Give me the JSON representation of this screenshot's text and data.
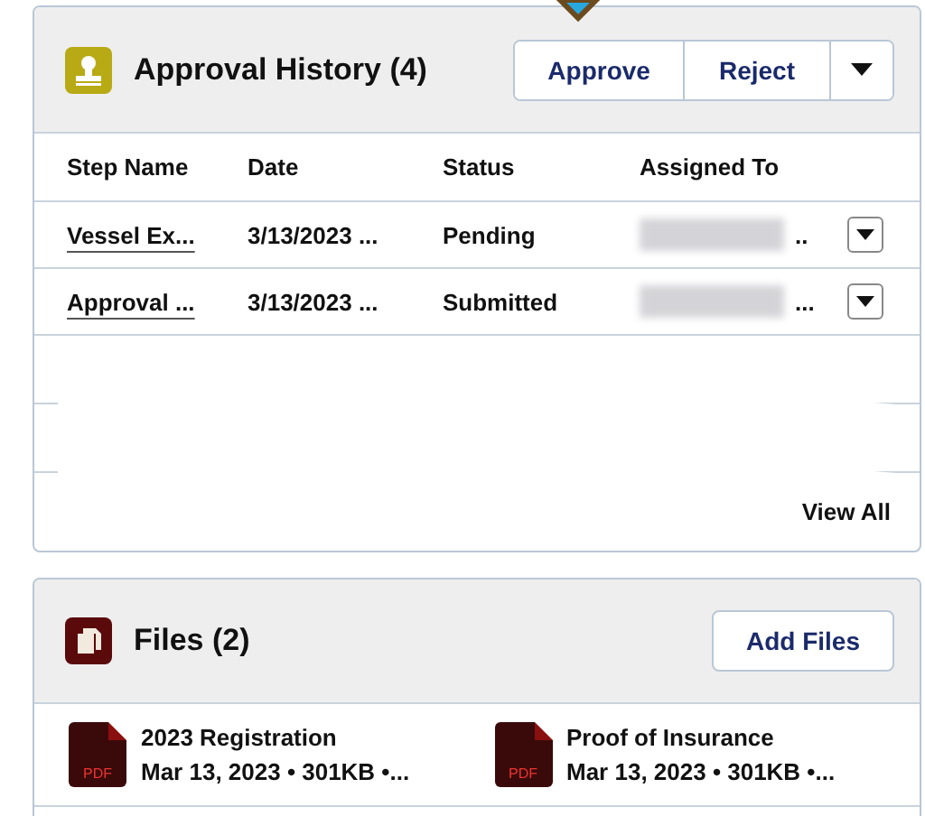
{
  "approval_history": {
    "title": "Approval History (4)",
    "buttons": [
      "Approve",
      "Reject"
    ],
    "columns": [
      "Step Name",
      "Date",
      "Status",
      "Assigned To"
    ],
    "rows": [
      {
        "step_name": "Vessel Ex...",
        "date": "3/13/2023 ...",
        "status": "Pending",
        "assigned_to": ".."
      },
      {
        "step_name": "Approval ...",
        "date": "3/13/2023 ...",
        "status": "Submitted",
        "assigned_to": "..."
      }
    ],
    "view_all": "View All"
  },
  "files": {
    "title": "Files (2)",
    "button": "Add Files",
    "items": [
      {
        "name": "2023 Registration",
        "details": "Mar 13, 2023 • 301KB •...",
        "type_label": "PDF"
      },
      {
        "name": "Proof of Insurance",
        "details": "Mar 13, 2023 • 301KB •...",
        "type_label": "PDF"
      }
    ]
  }
}
